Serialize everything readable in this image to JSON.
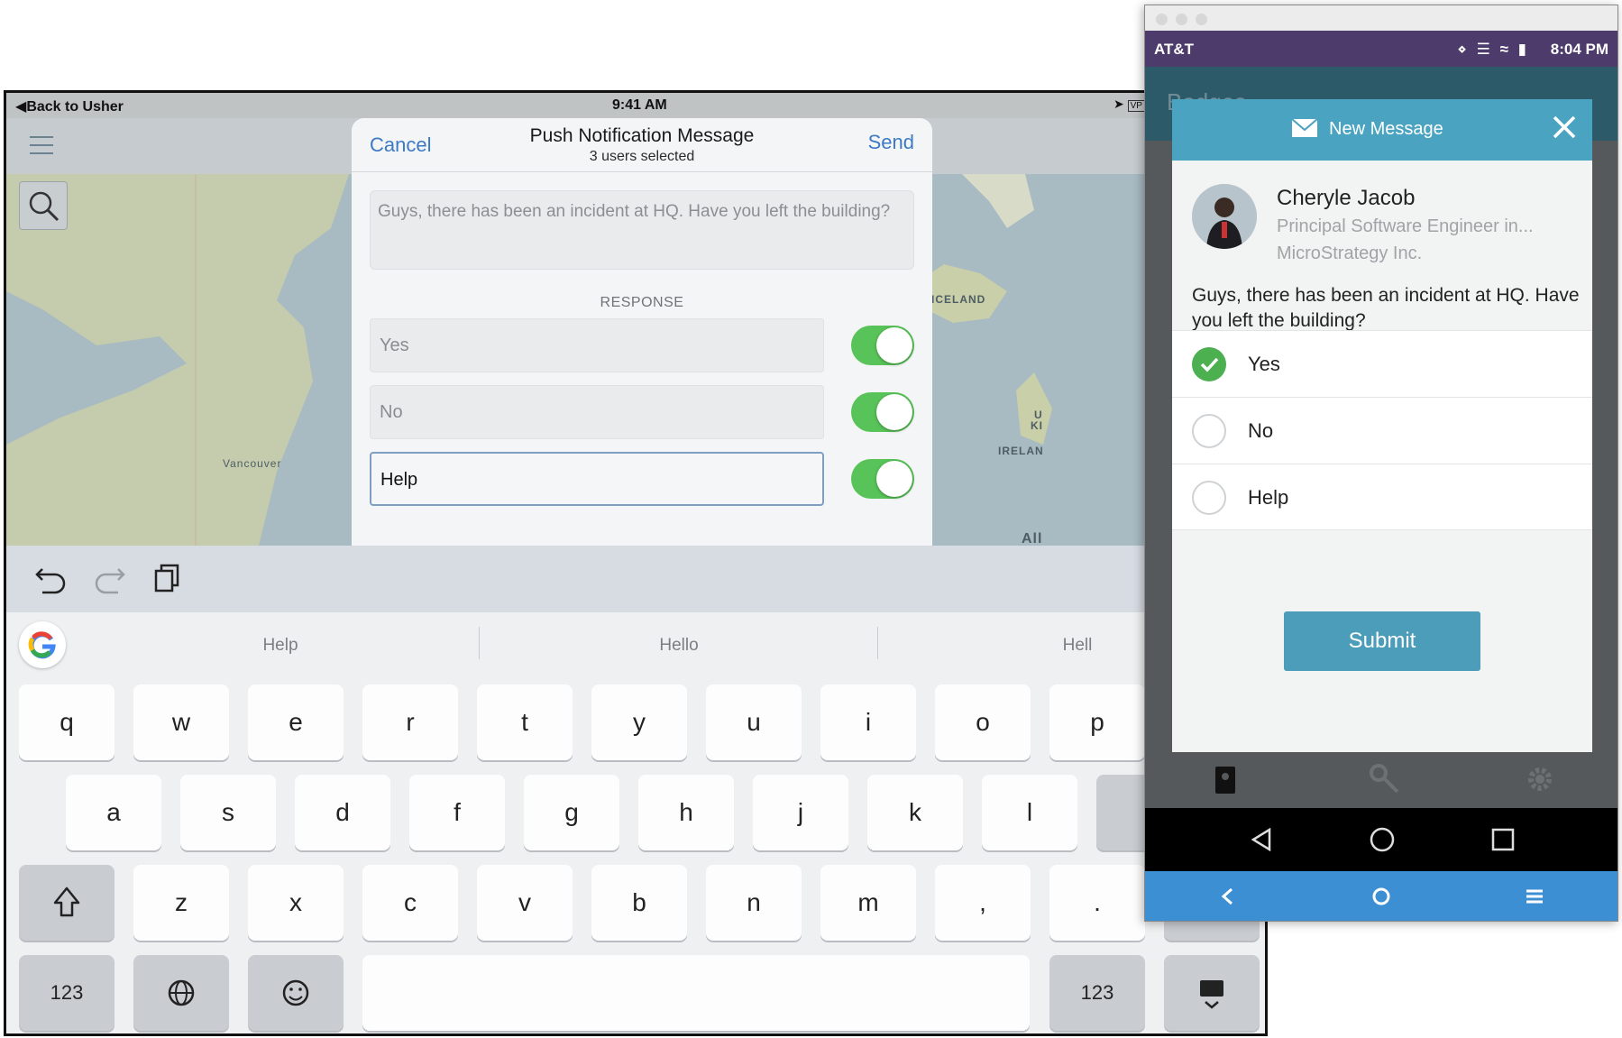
{
  "ipad": {
    "status": {
      "back": "Back to Usher",
      "time": "9:41 AM",
      "right": "VP"
    },
    "map_labels": {
      "iceland": "ICELAND",
      "vancouver": "Vancouver",
      "ireland": "IRELAN",
      "ki": "KI",
      "u": "U",
      "all": "All"
    },
    "modal": {
      "cancel": "Cancel",
      "title": "Push Notification Message",
      "subtitle": "3 users selected",
      "send": "Send",
      "message": "Guys, there has been an incident at HQ. Have you left the building?",
      "response_label": "RESPONSE",
      "responses": [
        {
          "label": "Yes",
          "enabled": true
        },
        {
          "label": "No",
          "enabled": true
        },
        {
          "label": "Help",
          "enabled": true
        }
      ]
    },
    "keyboard": {
      "suggestions": [
        "Help",
        "Hello",
        "Hell"
      ],
      "row1": [
        "q",
        "w",
        "e",
        "r",
        "t",
        "y",
        "u",
        "i",
        "o",
        "p"
      ],
      "row2": [
        "a",
        "s",
        "d",
        "f",
        "g",
        "h",
        "j",
        "k",
        "l"
      ],
      "row3": [
        "z",
        "x",
        "c",
        "v",
        "b",
        "n",
        "m",
        ",",
        "."
      ],
      "num_left": "123",
      "num_right": "123"
    }
  },
  "android": {
    "status": {
      "carrier": "AT&T",
      "time": "8:04 PM"
    },
    "app_title": "Badges",
    "dialog": {
      "title": "New Message",
      "sender_name": "Cheryle Jacob",
      "sender_role": "Principal Software Engineer in...",
      "sender_company": "MicroStrategy Inc.",
      "message": "Guys, there has been an incident at HQ. Have you left the building?",
      "options": [
        {
          "label": "Yes",
          "selected": true
        },
        {
          "label": "No",
          "selected": false
        },
        {
          "label": "Help",
          "selected": false
        }
      ],
      "submit": "Submit"
    }
  },
  "colors": {
    "ios_blue": "#3d7ac4",
    "toggle_green": "#58c358",
    "android_teal": "#4aa3c0",
    "check_green": "#4caf50"
  }
}
